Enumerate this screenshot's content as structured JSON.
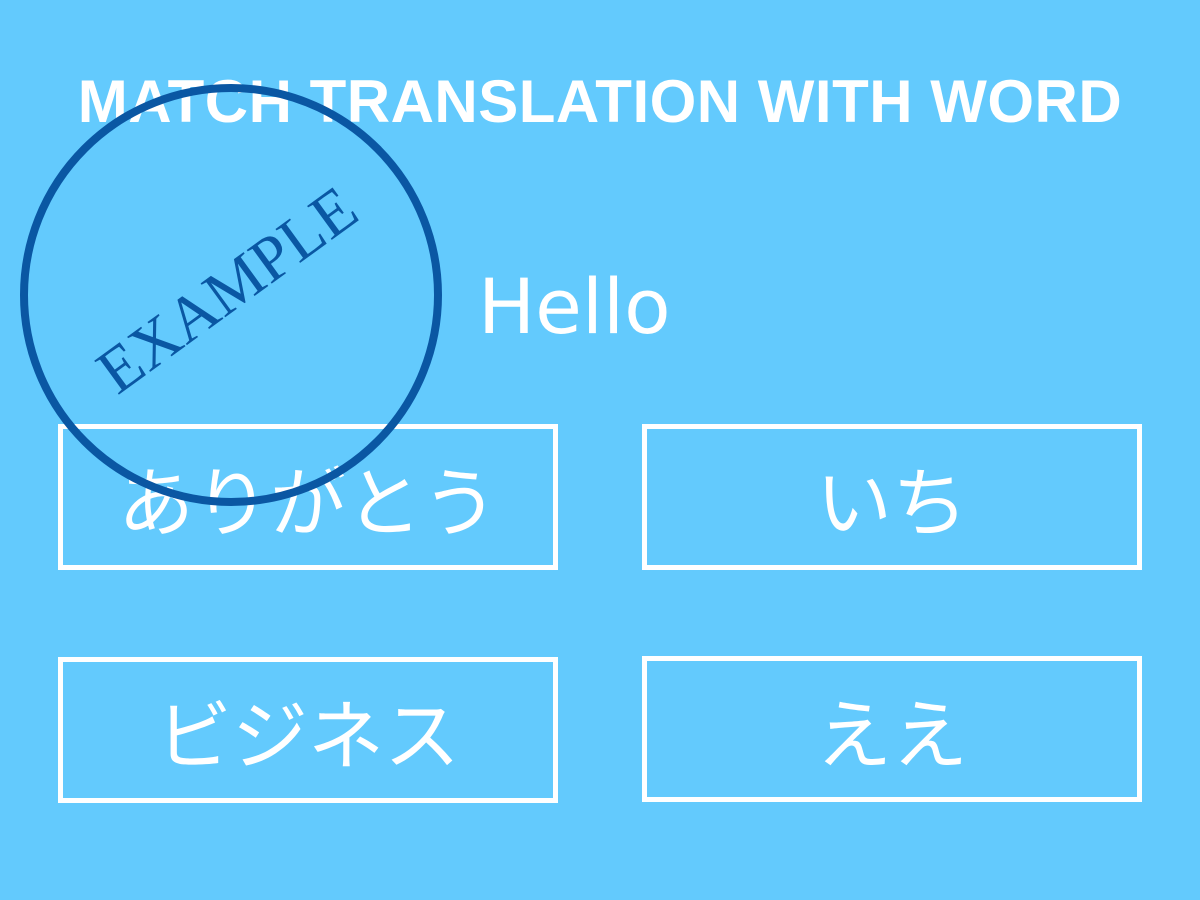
{
  "exercise": {
    "instruction": "MATCH TRANSLATION WITH WORD",
    "prompt_word": "Hello",
    "options": [
      {
        "label": "ありがとう"
      },
      {
        "label": "いち"
      },
      {
        "label": "ビジネス"
      },
      {
        "label": "ええ"
      }
    ]
  },
  "stamp": {
    "text": "EXAMPLE",
    "color": "#0a57a3"
  },
  "colors": {
    "background": "#63cafd",
    "foreground": "#ffffff"
  }
}
